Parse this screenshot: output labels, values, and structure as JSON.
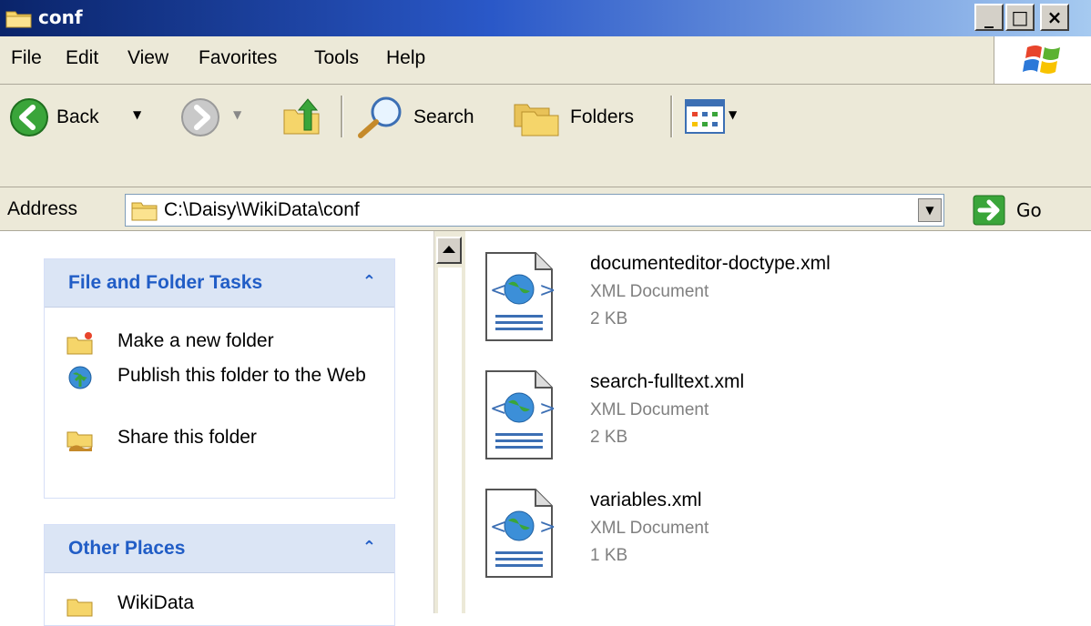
{
  "window": {
    "title": "conf",
    "min_label": "_",
    "max_label": "□",
    "close_label": "×"
  },
  "menu": {
    "items": [
      "File",
      "Edit",
      "View",
      "Favorites",
      "Tools",
      "Help"
    ]
  },
  "toolbar": {
    "back_label": "Back",
    "search_label": "Search",
    "folders_label": "Folders"
  },
  "address": {
    "label": "Address",
    "value": "C:\\Daisy\\WikiData\\conf",
    "go_label": "Go"
  },
  "tasks": {
    "file_folder": {
      "title": "File and Folder Tasks",
      "items": [
        {
          "label": "Make a new folder",
          "icon": "new-folder-icon"
        },
        {
          "label": "Publish this folder to the Web",
          "icon": "publish-web-icon"
        },
        {
          "label": "Share this folder",
          "icon": "share-folder-icon"
        }
      ]
    },
    "other_places": {
      "title": "Other Places",
      "items": [
        {
          "label": "WikiData",
          "icon": "folder-icon"
        }
      ]
    }
  },
  "files": [
    {
      "name": "documenteditor-doctype.xml",
      "type": "XML Document",
      "size": "2 KB"
    },
    {
      "name": "search-fulltext.xml",
      "type": "XML Document",
      "size": "2 KB"
    },
    {
      "name": "variables.xml",
      "type": "XML Document",
      "size": "1 KB"
    }
  ],
  "colors": {
    "title_bar_start": "#0a246a",
    "title_bar_end": "#a6caf0",
    "task_title": "#215dc6",
    "secondary_text": "#808080"
  }
}
